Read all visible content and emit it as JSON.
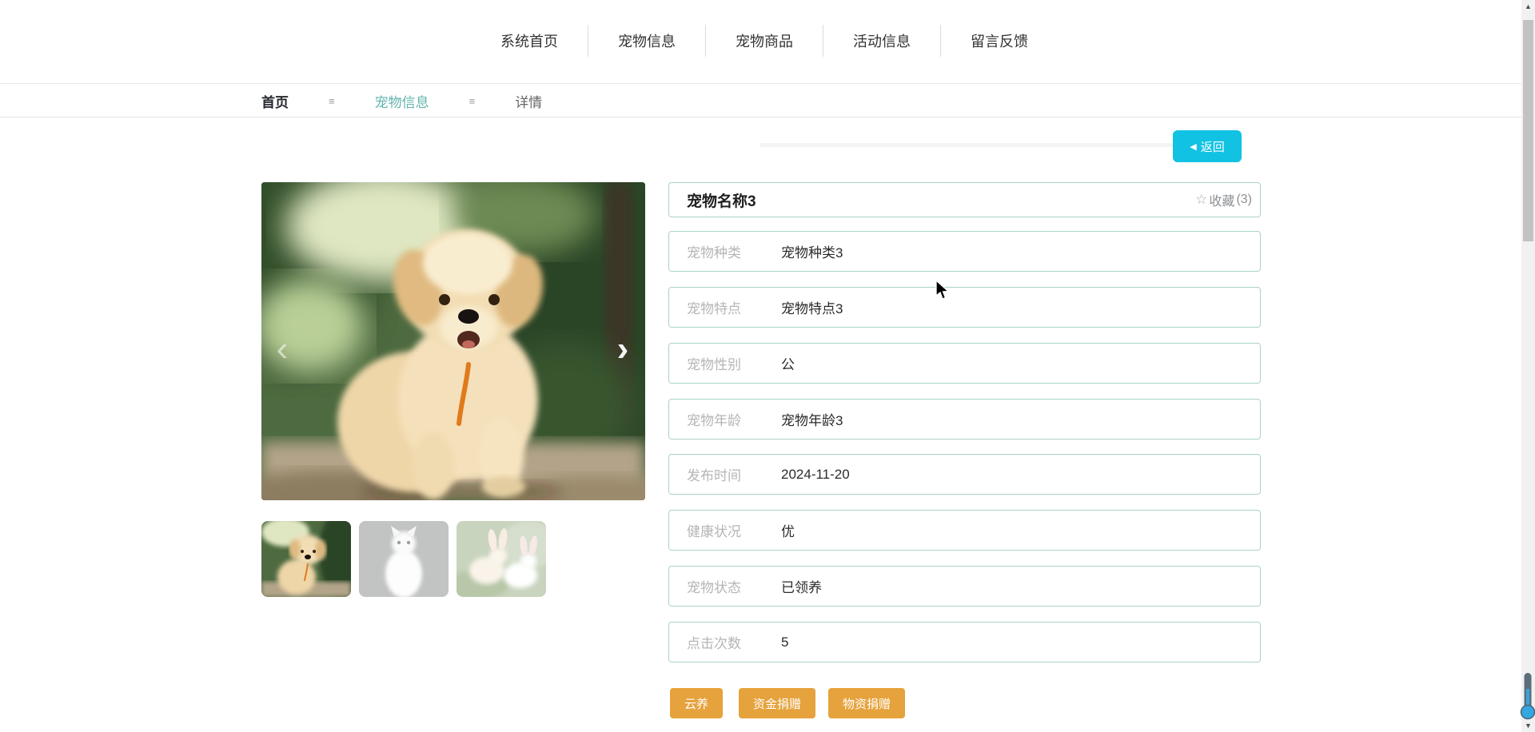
{
  "nav": {
    "items": [
      {
        "label": "系统首页"
      },
      {
        "label": "宠物信息"
      },
      {
        "label": "宠物商品"
      },
      {
        "label": "活动信息"
      },
      {
        "label": "留言反馈"
      }
    ]
  },
  "breadcrumb": {
    "home": "首页",
    "separator": "≡",
    "section": "宠物信息",
    "current": "详情"
  },
  "back_button": {
    "icon": "◀",
    "label": "返回"
  },
  "carousel": {
    "prev_icon": "‹",
    "next_icon": "›",
    "main_image": "golden-retriever-puppy-photo",
    "thumbnails": [
      {
        "name": "golden-retriever-puppy-thumbnail",
        "state": "active"
      },
      {
        "name": "white-cat-thumbnail",
        "state": "inactive"
      },
      {
        "name": "white-rabbits-thumbnail",
        "state": "inactive"
      }
    ]
  },
  "detail": {
    "title": "宠物名称3",
    "favorite": {
      "star": "☆",
      "label": "收藏",
      "count": "(3)"
    },
    "rows": [
      {
        "label": "宠物种类",
        "value": "宠物种类3"
      },
      {
        "label": "宠物特点",
        "value": "宠物特点3"
      },
      {
        "label": "宠物性别",
        "value": "公"
      },
      {
        "label": "宠物年龄",
        "value": "宠物年龄3"
      },
      {
        "label": "发布时间",
        "value": "2024-11-20"
      },
      {
        "label": "健康状况",
        "value": "优"
      },
      {
        "label": "宠物状态",
        "value": "已领养"
      },
      {
        "label": "点击次数",
        "value": "5"
      }
    ],
    "actions": [
      {
        "label": "云养"
      },
      {
        "label": "资金捐赠"
      },
      {
        "label": "物资捐赠"
      }
    ]
  },
  "scrollbar": {
    "up_icon": "▲",
    "down_icon": "▼"
  },
  "colors": {
    "accent_teal": "#63b5ad",
    "box_border_teal": "#abd3cb",
    "back_button_cyan": "#12c2e3",
    "action_orange": "#e6a23c",
    "label_gray": "#b5b5b5",
    "nav_text": "#333333"
  }
}
